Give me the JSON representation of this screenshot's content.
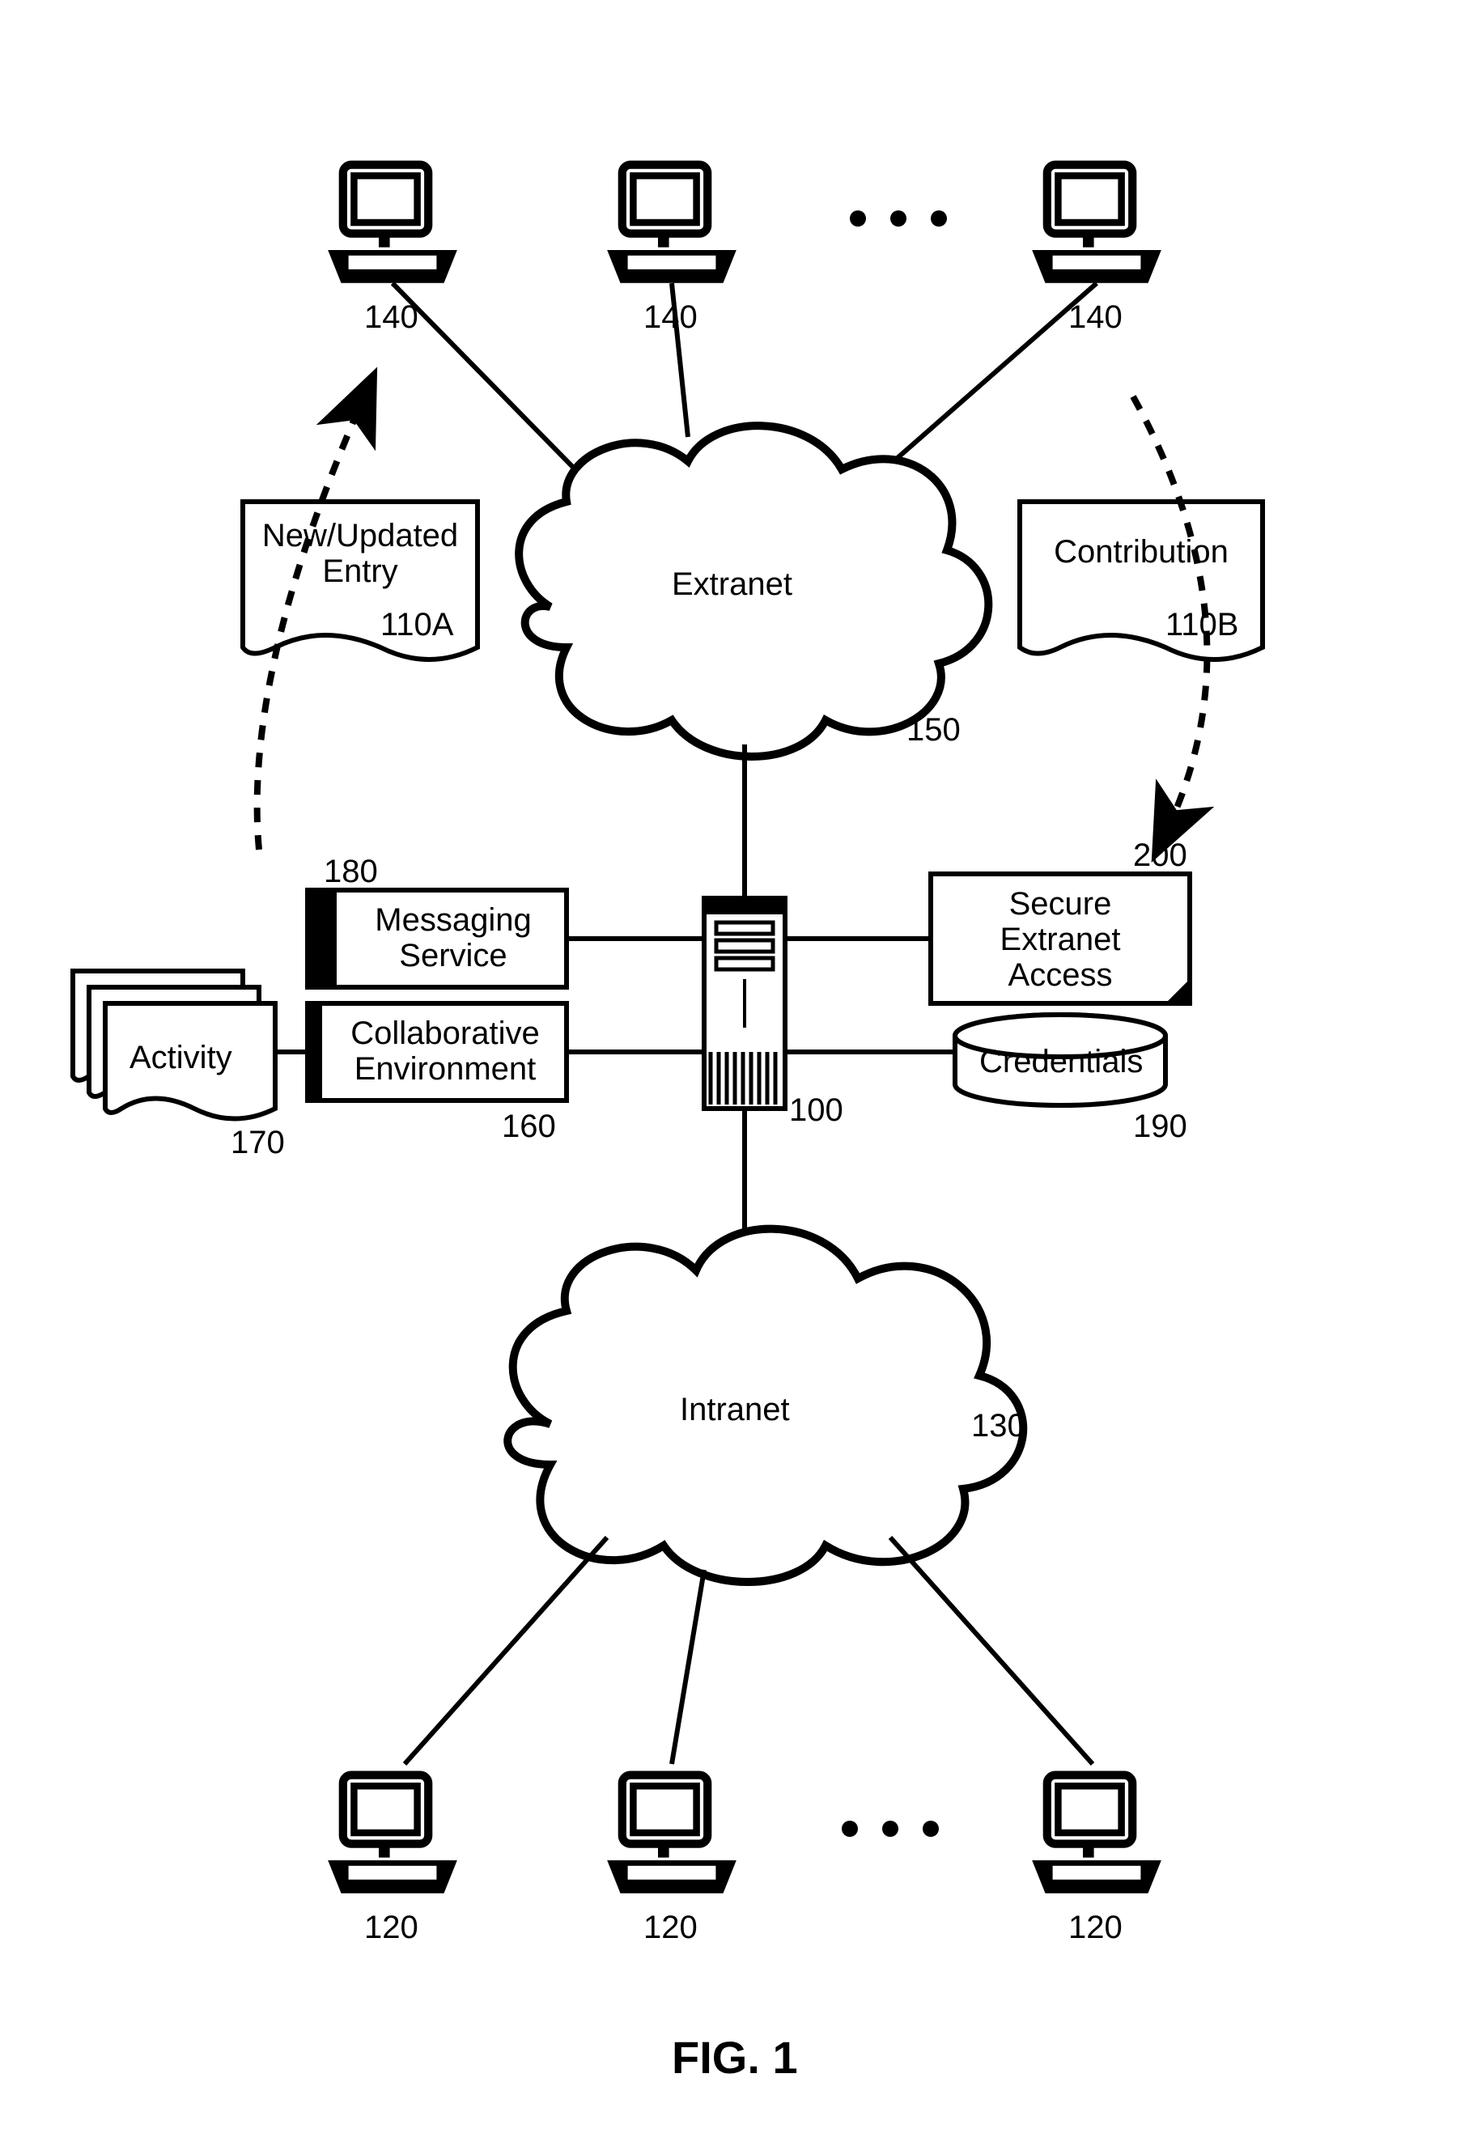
{
  "figure": {
    "caption": "FIG. 1"
  },
  "clouds": {
    "extranet": {
      "label": "Extranet",
      "ref": "150"
    },
    "intranet": {
      "label": "Intranet",
      "ref": "130"
    }
  },
  "documents": {
    "entry": {
      "label": "New/Updated\nEntry",
      "ref": "110A"
    },
    "contribution": {
      "label": "Contribution",
      "ref": "110B"
    }
  },
  "boxes": {
    "messaging": {
      "label": "Messaging\nService",
      "ref": "180"
    },
    "collab": {
      "label": "Collaborative\nEnvironment",
      "ref": "160"
    },
    "activity": {
      "label": "Activity",
      "ref": "170"
    },
    "secure": {
      "label": "Secure\nExtranet\nAccess",
      "ref": "200"
    }
  },
  "db": {
    "credentials": {
      "label": "Credentials",
      "ref": "190"
    }
  },
  "server": {
    "ref": "100"
  },
  "terminals": {
    "top_ref": "140",
    "bottom_ref": "120"
  }
}
